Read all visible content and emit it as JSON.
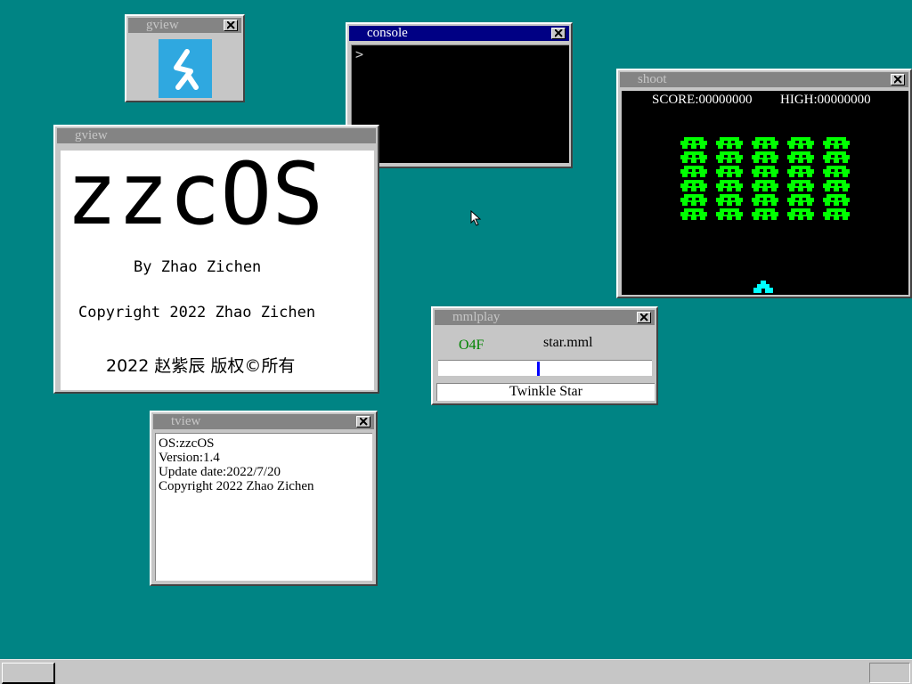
{
  "windows": {
    "gview_icon": {
      "title": "gview"
    },
    "console": {
      "title": "console",
      "prompt": ">"
    },
    "shoot": {
      "title": "shoot",
      "score_label": "SCORE:00000000",
      "high_label": "HIGH:00000000",
      "invader_rows": 6,
      "invader_cols": 5,
      "invader_color": "#00ff00",
      "player_color": "#00ffff"
    },
    "gview_about": {
      "title": "gview",
      "logo_text": "zzcOS",
      "byline": "By Zhao Zichen",
      "copyright_en": "Copyright 2022 Zhao Zichen",
      "copyright_cn": "2022 赵紫辰 版权©所有"
    },
    "mmlplay": {
      "title": "mmlplay",
      "position": "O4F",
      "filename": "star.mml",
      "progress_fraction": 0.47,
      "song_title": "Twinkle Star"
    },
    "tview": {
      "title": "tview",
      "lines": [
        "OS:zzcOS",
        "Version:1.4",
        "Update date:2022/7/20",
        "Copyright 2022 Zhao Zichen"
      ]
    }
  },
  "colors": {
    "desktop": "#008484",
    "active_title": "#000084",
    "inactive_title": "#848484"
  }
}
